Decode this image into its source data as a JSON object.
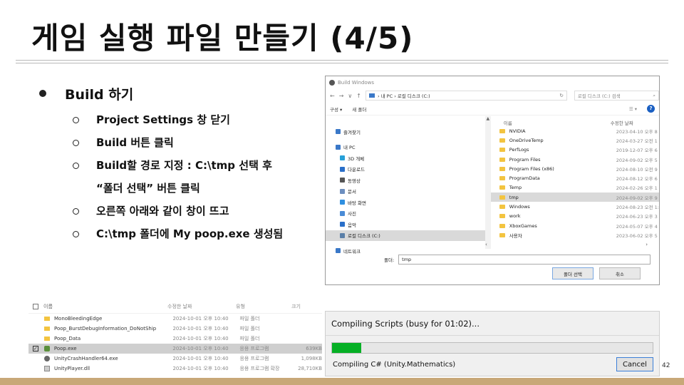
{
  "slide": {
    "title": "게임 실행 파일 만들기 (4/5)",
    "page_number": "42"
  },
  "bullets": {
    "main": "Build 하기",
    "items": [
      "Project Settings 창 닫기",
      "Build 버튼 클릭",
      "Build할 경로 지정 : C:\\tmp 선택 후",
      "“폴더 선택” 버튼 클릭",
      "오른쪽 아래와 같이 창이 뜨고",
      "C:\\tmp 폴더에 My poop.exe 생성됨"
    ]
  },
  "build_dialog": {
    "title": "Build Windows",
    "nav_arrows": [
      "←",
      "→",
      "∨",
      "↑"
    ],
    "address": "› 내 PC › 로컬 디스크 (C:)",
    "search_placeholder": "로컬 디스크 (C:) 검색",
    "toolbar": {
      "organize": "구성 ▾",
      "new_folder": "새 폴더",
      "help": "?"
    },
    "nav_items": [
      {
        "label": "즐겨찾기",
        "icon": "star-icon",
        "color": "#3a78c8"
      },
      {
        "label": "내 PC",
        "icon": "pc-icon",
        "color": "#3a78c8"
      },
      {
        "label": "3D 개체",
        "icon": "cube-icon",
        "color": "#27a0d8"
      },
      {
        "label": "다운로드",
        "icon": "download-icon",
        "color": "#2a6fc9"
      },
      {
        "label": "동영상",
        "icon": "video-icon",
        "color": "#555555"
      },
      {
        "label": "문서",
        "icon": "document-icon",
        "color": "#6c8ebf"
      },
      {
        "label": "바탕 화면",
        "icon": "desktop-icon",
        "color": "#2f8fe0"
      },
      {
        "label": "사진",
        "icon": "picture-icon",
        "color": "#4a8bd6"
      },
      {
        "label": "음악",
        "icon": "music-icon",
        "color": "#2a6fc9"
      },
      {
        "label": "로컬 디스크 (C:)",
        "icon": "drive-icon",
        "color": "#5a7fa8"
      },
      {
        "label": "네트워크",
        "icon": "network-icon",
        "color": "#3a78c8"
      }
    ],
    "columns": {
      "name": "이름",
      "modified": "수정한 날짜"
    },
    "files": [
      {
        "name": "NVIDIA",
        "date": "2023-04-10 오후 8"
      },
      {
        "name": "OneDriveTemp",
        "date": "2024-03-27 오전 1"
      },
      {
        "name": "PerfLogs",
        "date": "2019-12-07 오후 6"
      },
      {
        "name": "Program Files",
        "date": "2024-09-02 오후 5"
      },
      {
        "name": "Program Files (x86)",
        "date": "2024-08-10 오전 9"
      },
      {
        "name": "ProgramData",
        "date": "2024-08-12 오후 6"
      },
      {
        "name": "Temp",
        "date": "2024-02-26 오후 1"
      },
      {
        "name": "tmp",
        "date": "2024-09-02 오후 9"
      },
      {
        "name": "Windows",
        "date": "2024-08-23 오전 1:"
      },
      {
        "name": "work",
        "date": "2024-06-23 오후 3"
      },
      {
        "name": "XboxGames",
        "date": "2024-05-07 오후 4"
      },
      {
        "name": "사용자",
        "date": "2023-06-02 오후 5"
      }
    ],
    "folder_label": "폴더:",
    "folder_value": "tmp",
    "select_button": "폴더 선택",
    "cancel_button": "취소"
  },
  "explorer": {
    "columns": {
      "name": "이름",
      "date": "수정한 날짜",
      "type": "유형",
      "size": "크기"
    },
    "rows": [
      {
        "name": "MonoBleedingEdge",
        "date": "2024-10-01 오후 10:40",
        "type": "파일 폴더",
        "size": "",
        "icon": "folder-icon"
      },
      {
        "name": "Poop_BurstDebugInformation_DoNotShip",
        "date": "2024-10-01 오후 10:40",
        "type": "파일 폴더",
        "size": "",
        "icon": "folder-icon"
      },
      {
        "name": "Poop_Data",
        "date": "2024-10-01 오후 10:40",
        "type": "파일 폴더",
        "size": "",
        "icon": "folder-icon"
      },
      {
        "name": "Poop.exe",
        "date": "2024-10-01 오후 10:40",
        "type": "응용 프로그램",
        "size": "639KB",
        "icon": "exe-icon"
      },
      {
        "name": "UnityCrashHandler64.exe",
        "date": "2024-10-01 오후 10:40",
        "type": "응용 프로그램",
        "size": "1,098KB",
        "icon": "unity-icon"
      },
      {
        "name": "UnityPlayer.dll",
        "date": "2024-10-01 오후 10:40",
        "type": "응용 프로그램 확장",
        "size": "28,710KB",
        "icon": "dll-icon"
      }
    ]
  },
  "compile_dialog": {
    "title": "Compiling Scripts (busy for 01:02)...",
    "progress": 0.09,
    "status": "Compiling C# (Unity.Mathematics)",
    "cancel_label": "Cancel"
  }
}
